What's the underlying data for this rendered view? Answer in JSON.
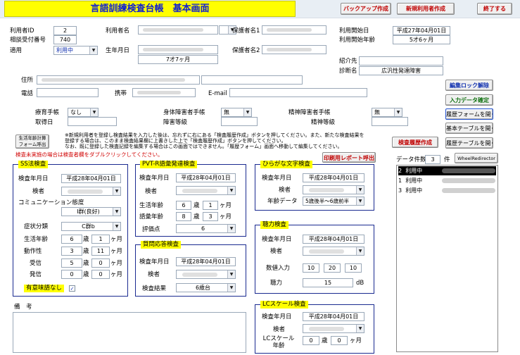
{
  "header": {
    "title": "言語訓練検査台帳　基本画面",
    "backup_button": "バックアップ作成",
    "new_user_button": "新規利用者作成",
    "exit_button": "終了する"
  },
  "user": {
    "id_label": "利用者ID",
    "id_value": "2",
    "consult_no_label": "相談受付番号",
    "consult_no_value": "740",
    "applied_label": "適用",
    "applied_value": "利用中",
    "name_label": "利用者名",
    "dob_label": "生年月日",
    "age_value": "7才7ヶ月",
    "guardian1_label": "保護者名1",
    "guardian2_label": "保護者名2",
    "start_date_label": "利用開始日",
    "start_date_value": "平成27年04月01日",
    "start_age_label": "利用開始年齢",
    "start_age_value": "5才6ヶ月",
    "referral_label": "紹介先",
    "diagnosis_label": "診断名",
    "diagnosis_value": "広汎性発達障害",
    "address_label": "住所",
    "phone_label": "電話",
    "mobile_label": "携帯",
    "email_label": "E-mail",
    "rehab_label": "療育手帳",
    "rehab_value": "なし",
    "acquired_label": "取得日",
    "physical_label": "身体障害者手帳",
    "physical_value": "無",
    "disability_grade_label": "障害等級",
    "mental_label": "精神障害者手帳",
    "mental_value": "無",
    "mental_grade_label": "精神等級"
  },
  "side_buttons": {
    "edit_unlock": "編集ロック解除",
    "confirm_input": "入力データ確定",
    "open_history_form": "履歴フォームを開く",
    "open_base_table": "基本テーブルを開く",
    "open_history_table": "履歴テーブルを開く",
    "history_create": "検査履歴作成",
    "print_report": "印刷用レポート呼出",
    "calc_form": "生活年齢計算 フォーム呼出"
  },
  "notes": {
    "line1": "※新規利用者を登録し検査結果を入力した後は、忘れずに右にある「検査履歴作成」ボタンを押してください。また、新たな検査結果を",
    "line2": "登録する場合は、このまま検査結果欄に上書きした上で「検査履歴作成」ボタンを押してください。",
    "line3": "なお、既に登録した検査記録を編集する場合はこの画面ではできません。「履歴フォーム」画面へ移動して編集してください。",
    "not_done": "検査未実施の場合は検査者欄をダブルクリックしてください。"
  },
  "ss": {
    "title": "SS法検査",
    "date_label": "検査年月日",
    "date_value": "平成28年04月01日",
    "examiner_label": "検者",
    "comm_label": "コミュニケーション態度",
    "comm_value": "Ⅰ群(良好)",
    "symptom_label": "症状分類",
    "symptom_value": "C群b",
    "life_age_label": "生活年齢",
    "life_age_y": "6",
    "life_age_m": "1",
    "motion_label": "動作性",
    "motion_y": "3",
    "motion_m": "11",
    "receive_label": "受信",
    "receive_y": "5",
    "receive_m": "0",
    "send_label": "発信",
    "send_y": "0",
    "send_m": "0",
    "years_unit": "歳",
    "months_unit": "ヶ月",
    "meaningful_label": "有意味語なし"
  },
  "pvt": {
    "title": "PVT-R語彙発達検査",
    "date_label": "検査年月日",
    "date_value": "平成28年04月01日",
    "examiner_label": "検者",
    "life_age_label": "生活年齢",
    "life_age_y": "6",
    "life_age_m": "1",
    "vocab_age_label": "語彙年齢",
    "vocab_age_y": "8",
    "vocab_age_m": "3",
    "score_label": "評価点",
    "score_value": "6",
    "years_unit": "歳",
    "months_unit": "ヶ月"
  },
  "qa": {
    "title": "質問応答検査",
    "date_label": "検査年月日",
    "date_value": "平成28年04月01日",
    "examiner_label": "検者",
    "result_label": "検査結果",
    "result_value": "6歳台"
  },
  "hiragana": {
    "title": "ひらがな文字検査",
    "date_label": "検査年月日",
    "date_value": "平成28年04月01日",
    "examiner_label": "検者",
    "age_data_label": "年齢データ",
    "age_data_value": "5歳後半～6歳前半"
  },
  "hearing": {
    "title": "聴力検査",
    "date_label": "検査年月日",
    "date_value": "平成28年04月01日",
    "examiner_label": "検者",
    "num_label": "数値入力",
    "v1": "10",
    "v2": "20",
    "v3": "10",
    "hearing_label": "聴力",
    "hearing_value": "15",
    "unit": "dB"
  },
  "lc": {
    "title": "LCスケール検査",
    "date_label": "検査年月日",
    "date_value": "平成28年04月01日",
    "examiner_label": "検者",
    "age_label": "LCスケール 年齢",
    "age_y": "0",
    "age_m": "0",
    "years_unit": "歳",
    "months_unit": "ヶ月"
  },
  "remarks": {
    "label": "備　考"
  },
  "history": {
    "count_label": "データ件数",
    "count_value": "3",
    "count_unit": "件",
    "wheel_button": "WheelRedirector",
    "rows": [
      {
        "no": "2",
        "status": "利用中"
      },
      {
        "no": "1",
        "status": "利用中"
      },
      {
        "no": "3",
        "status": "利用中"
      }
    ]
  }
}
